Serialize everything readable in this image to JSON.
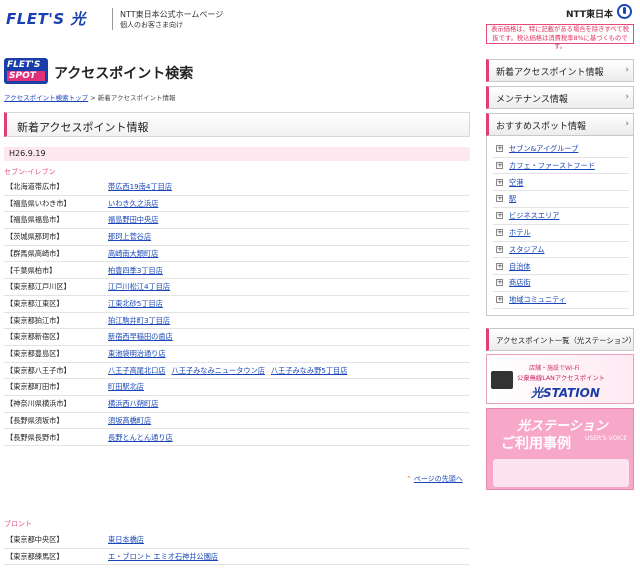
{
  "header": {
    "logo": "FLET'S 光",
    "company_line1": "NTT東日本公式ホームページ",
    "company_line2": "個人のお客さま向け",
    "ntt_logo": "NTT東日本",
    "price_note": "表示価格は、特に記載がある場合を除きすべて税抜です。税込価格は消費税率8%に基づくものです。"
  },
  "title": {
    "spot_logo_line1": "FLET'S",
    "spot_logo_line2": "SPOT",
    "text": "アクセスポイント検索"
  },
  "breadcrumb": {
    "parent": "アクセスポイント検索トップ",
    "separator": ">",
    "current": "新着アクセスポイント情報"
  },
  "main": {
    "section_title": "新着アクセスポイント情報",
    "date": "H26.9.19",
    "groups": [
      {
        "chain": "セブン-イレブン",
        "rows": [
          {
            "location": "【北海道帯広市】",
            "stores": [
              "帯広西19南4丁目店"
            ]
          },
          {
            "location": "【福島県いわき市】",
            "stores": [
              "いわき久之浜店"
            ]
          },
          {
            "location": "【福島県福島市】",
            "stores": [
              "福島野田中央店"
            ]
          },
          {
            "location": "【茨城県那珂市】",
            "stores": [
              "那珂上菅谷店"
            ]
          },
          {
            "location": "【群馬県高崎市】",
            "stores": [
              "高崎南大類町店"
            ]
          },
          {
            "location": "【千葉県柏市】",
            "stores": [
              "柏豊四季3丁目店"
            ]
          },
          {
            "location": "【東京都江戸川区】",
            "stores": [
              "江戸川松江4丁目店"
            ]
          },
          {
            "location": "【東京都江東区】",
            "stores": [
              "江東北砂5丁目店"
            ]
          },
          {
            "location": "【東京都狛江市】",
            "stores": [
              "狛江駒井町3丁目店"
            ]
          },
          {
            "location": "【東京都新宿区】",
            "stores": [
              "新宿西早稲田の歯店"
            ]
          },
          {
            "location": "【東京都豊島区】",
            "stores": [
              "東池袋明治通り店"
            ]
          },
          {
            "location": "【東京都八王子市】",
            "stores": [
              "八王子高尾北口店",
              "八王子みなみニュータウン店",
              "八王子みなみ野5丁目店"
            ]
          },
          {
            "location": "【東京都町田市】",
            "stores": [
              "町田駅北店"
            ]
          },
          {
            "location": "【神奈川県横浜市】",
            "stores": [
              "横浜西八朔町店"
            ]
          },
          {
            "location": "【長野県須坂市】",
            "stores": [
              "須坂高橋町店"
            ]
          },
          {
            "location": "【長野県長野市】",
            "stores": [
              "長野とんとん通り店"
            ]
          }
        ]
      },
      {
        "chain": "ブロント",
        "rows": [
          {
            "location": "【東京都中央区】",
            "stores": [
              "東日本橋店"
            ]
          },
          {
            "location": "【東京都練馬区】",
            "stores": [
              "エ・ブロント エミオ石神井公園店"
            ]
          }
        ]
      }
    ],
    "to_top": "ページの先頭へ"
  },
  "sidebar": {
    "nav": [
      "新着アクセスポイント情報",
      "メンテナンス情報",
      "おすすめスポット情報"
    ],
    "chevron": "›",
    "spots": [
      "セブン&アイグループ",
      "カフェ・ファーストフード",
      "空港",
      "駅",
      "ビジネスエリア",
      "ホテル",
      "スタジアム",
      "自治体",
      "商店街",
      "地域コミュニティ"
    ],
    "list_button": "アクセスポイント一覧（光ステーション）",
    "banner1": {
      "line1": "店舗・施設でWi-Fi",
      "line2": "公衆無線LANアクセスポイント",
      "line3": "光STATION"
    },
    "banner2": {
      "line1": "光ステーション",
      "line2": "ご利用事例",
      "line3": "USER'S VOICE"
    }
  },
  "colors": {
    "accent": "#e04070",
    "link": "#1a47b8",
    "brand": "#1a3ea8",
    "chain": "#e8508a",
    "date_bg": "#fde8f0"
  }
}
